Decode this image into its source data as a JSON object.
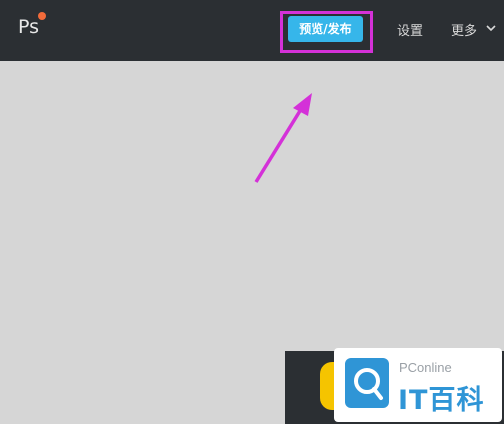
{
  "app": {
    "logo_text": "Ps",
    "badge_color": "#f26b3a"
  },
  "nav": {
    "preview_publish_label": "预览/发布",
    "settings_label": "设置",
    "more_label": "更多"
  },
  "icons": {
    "more_dropdown": "chevron-down-icon",
    "highlight": "magenta-arrow-pointer"
  },
  "colors": {
    "topbar_bg": "#2b2f33",
    "canvas_bg": "#d6d6d6",
    "primary_button": "#36b6ea",
    "highlight": "#d431d8"
  },
  "watermark": {
    "site_text": "PConline",
    "brand_text": "IT百科"
  }
}
